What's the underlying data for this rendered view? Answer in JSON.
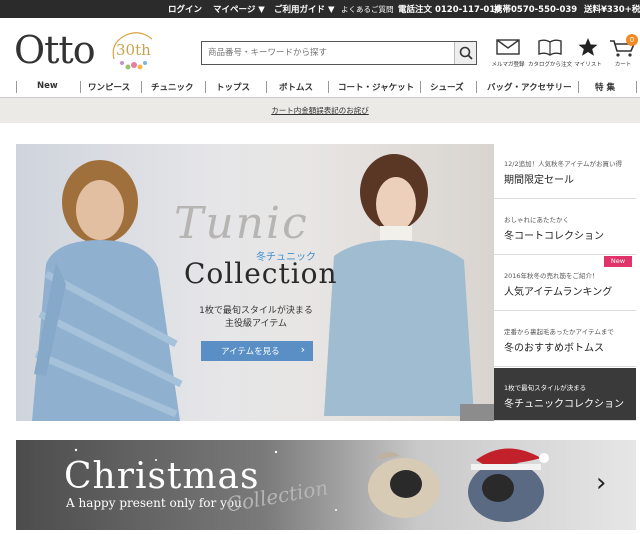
{
  "topbar": {
    "login": "ログイン",
    "mypage": "マイページ ▼",
    "guide": "ご利用ガイド ▼",
    "faq": "よくあるご質問",
    "phone": "電話注文 0120-117-010",
    "mobile": "携帯0570-550-039",
    "shipping": "送料¥330+税"
  },
  "header": {
    "logo": "Otto",
    "anniversary": "30th",
    "search_placeholder": "商品番号・キーワードから探す",
    "icons": [
      {
        "name": "mail-icon",
        "label": "メルマガ登録"
      },
      {
        "name": "catalog-icon",
        "label": "カタログから注文"
      },
      {
        "name": "star-icon",
        "label": "マイリスト"
      },
      {
        "name": "cart-icon",
        "label": "カート"
      }
    ],
    "cart_count": "0"
  },
  "nav": {
    "items": [
      "New",
      "ワンピース",
      "チュニック",
      "トップス",
      "ボトムス",
      "コート・ジャケット",
      "シューズ",
      "バッグ・アクセサリー",
      "特 集"
    ]
  },
  "notice": {
    "text": "カート内金額誤表記のお詫び"
  },
  "hero": {
    "script_title": "Tunic",
    "sub_jp": "冬チュニック",
    "main_title": "Collection",
    "desc1": "1枚で最旬スタイルが決まる",
    "desc2": "主役級アイテム",
    "button": "アイテムを見る"
  },
  "side_list": [
    {
      "sub": "12/2追加！人気秋冬アイテムがお買い得",
      "title": "期間限定セール"
    },
    {
      "sub": "おしゃれにあたたかく",
      "title": "冬コートコレクション"
    },
    {
      "sub": "2016年秋冬の売れ筋をご紹介！",
      "title": "人気アイテムランキング",
      "badge": "New"
    },
    {
      "sub": "定番から裏起毛あったかアイテムまで",
      "title": "冬のおすすめボトムス"
    },
    {
      "sub": "1枚で最旬スタイルが決まる",
      "title": "冬チュニックコレクション"
    }
  ],
  "christmas": {
    "title": "Christmas",
    "subtitle": "A happy present only for you",
    "collection": "Collection"
  },
  "colors": {
    "topbar": "#2b2b2b",
    "accent_blue": "#5a8fc6",
    "badge_orange": "#f08a24",
    "new_pink": "#e0336a"
  }
}
